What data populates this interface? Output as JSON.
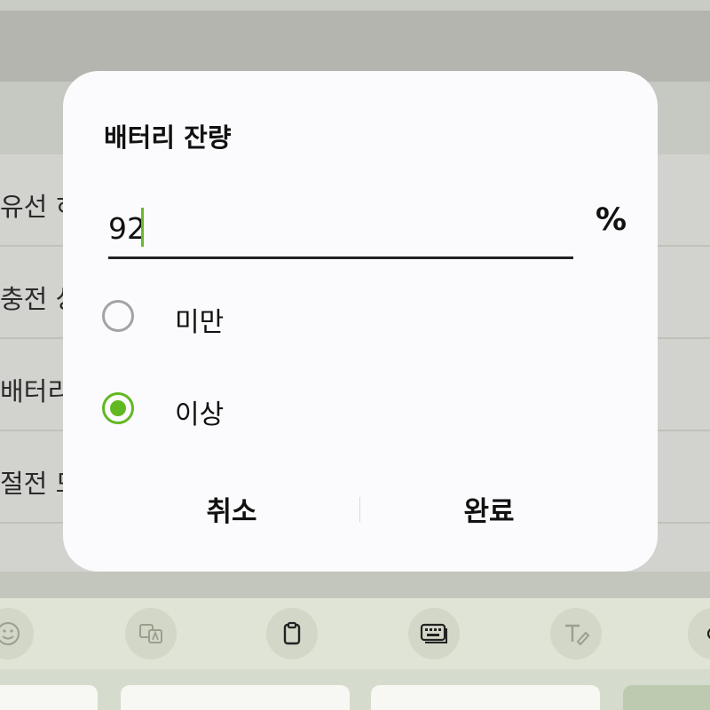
{
  "dialog": {
    "title": "배터리 잔량",
    "input_value": "92",
    "unit": "%",
    "options": [
      {
        "label": "미만",
        "selected": false
      },
      {
        "label": "이상",
        "selected": true
      }
    ],
    "cancel_label": "취소",
    "done_label": "완료"
  },
  "background": {
    "rows": [
      "유선 히",
      "충전 상",
      "배터리",
      "절전 모",
      ""
    ]
  },
  "colors": {
    "accent": "#62b821",
    "dialog_bg": "#fbfbfd",
    "scrim": "#c6c8c2"
  },
  "icons": [
    "emoji-icon",
    "translate-icon",
    "clipboard-icon",
    "keyboard-icon",
    "handwriting-icon"
  ]
}
